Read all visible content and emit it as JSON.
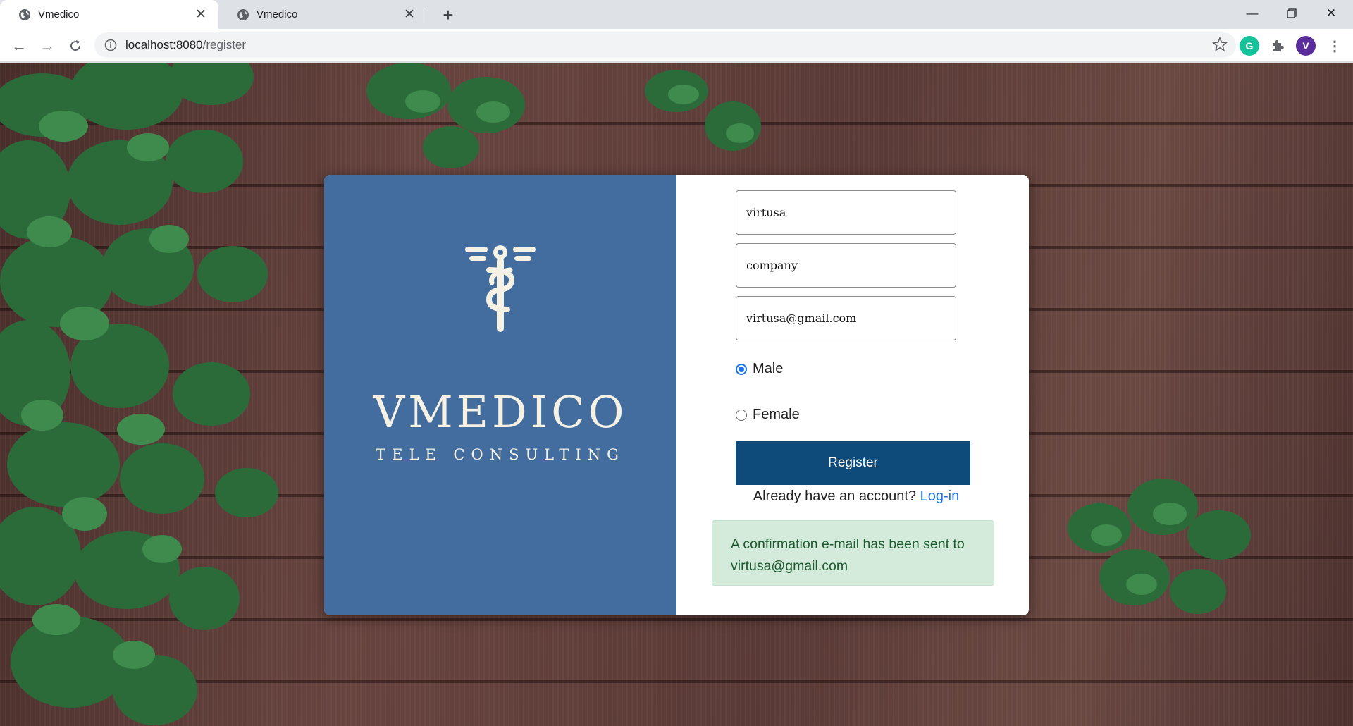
{
  "browser": {
    "tabs": [
      {
        "title": "Vmedico",
        "active": true
      },
      {
        "title": "Vmedico",
        "active": false
      }
    ],
    "url_host": "localhost:8080",
    "url_path": "/register",
    "profile_initial": "V",
    "extension_initial": "G"
  },
  "brand": {
    "name": "VMEDICO",
    "tagline": "TELE CONSULTING",
    "panel_color": "#426d9e"
  },
  "form": {
    "fields": [
      {
        "name": "first-name",
        "value": "virtusa"
      },
      {
        "name": "last-name",
        "value": "company"
      },
      {
        "name": "email",
        "value": "virtusa@gmail.com"
      }
    ],
    "gender_options": [
      {
        "label": "Male",
        "checked": true
      },
      {
        "label": "Female",
        "checked": false
      }
    ],
    "register_label": "Register",
    "login_prompt": "Already have an account?",
    "login_link": "Log-in",
    "confirmation_line1": "A confirmation e-mail has been sent to",
    "confirmation_line2": "virtusa@gmail.com"
  },
  "colors": {
    "register_button": "#0e4a7a",
    "alert_bg": "#d4eadb",
    "link": "#1a73e8"
  }
}
